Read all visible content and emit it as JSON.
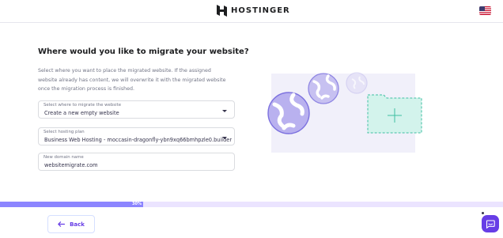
{
  "header": {
    "brand": "HOSTINGER",
    "logo_icon": "hostinger-h-logo",
    "language_icon": "us-flag-icon"
  },
  "main": {
    "title": "Where would you like to migrate your website?",
    "description": "Select where you want to place the migrated website. If the assigned website already has content, we will overwrite it with the migrated website once the migration process is finished.",
    "fields": {
      "migrate_target": {
        "label": "Select where to migrate the website",
        "value": "Create a new empty website"
      },
      "hosting_plan": {
        "label": "Select hosting plan",
        "value": "Business Web Hosting - moccasin-dragonfly-ybn9xq66bmhpzle0.builder"
      },
      "domain": {
        "label": "New domain name",
        "value": "websitemigrate.com"
      }
    },
    "illustration_icon": "globes-to-folder-illustration"
  },
  "progress": {
    "value_percent": 30,
    "label": "30%"
  },
  "footer": {
    "back_label": "Back",
    "back_icon": "arrow-left-icon",
    "chat_icon": "chat-bubble-icon"
  },
  "colors": {
    "accent": "#673de6",
    "progress_fill": "#8c85ff",
    "progress_track": "#ebe4ff",
    "text_dark": "#1d1e20",
    "text_muted": "#727586"
  }
}
